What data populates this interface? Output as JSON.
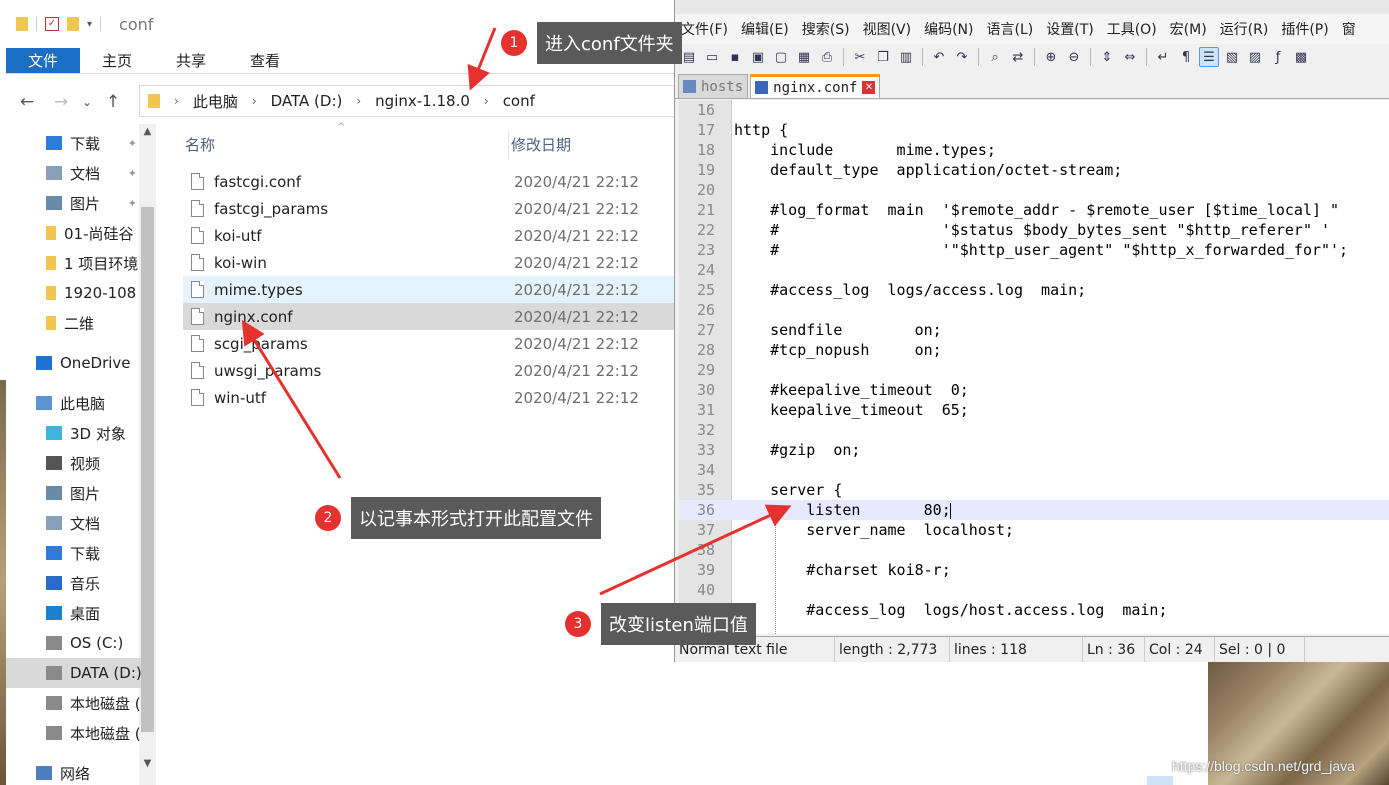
{
  "explorer": {
    "title": "conf",
    "ribbon_tabs": [
      "文件",
      "主页",
      "共享",
      "查看"
    ],
    "breadcrumbs": [
      "此电脑",
      "DATA (D:)",
      "nginx-1.18.0",
      "conf"
    ],
    "nav_items": [
      {
        "label": "下载",
        "icon": "download-arrow-icon",
        "pinned": true
      },
      {
        "label": "文档",
        "icon": "document-icon",
        "pinned": true
      },
      {
        "label": "图片",
        "icon": "picture-icon",
        "pinned": true
      },
      {
        "label": "01-尚硅谷",
        "icon": "folder-icon"
      },
      {
        "label": "1 项目环境",
        "icon": "folder-icon"
      },
      {
        "label": "1920-108",
        "icon": "folder-icon"
      },
      {
        "label": "二维",
        "icon": "folder-icon"
      },
      {
        "label": "OneDrive",
        "icon": "cloud-icon"
      },
      {
        "label": "此电脑",
        "icon": "computer-icon"
      },
      {
        "label": "3D 对象",
        "icon": "cube-icon"
      },
      {
        "label": "视频",
        "icon": "video-icon"
      },
      {
        "label": "图片",
        "icon": "picture-icon"
      },
      {
        "label": "文档",
        "icon": "document-icon"
      },
      {
        "label": "下载",
        "icon": "download-arrow-icon"
      },
      {
        "label": "音乐",
        "icon": "music-icon"
      },
      {
        "label": "桌面",
        "icon": "desktop-icon"
      },
      {
        "label": "OS (C:)",
        "icon": "drive-icon"
      },
      {
        "label": "DATA (D:)",
        "icon": "drive-icon",
        "selected": true
      },
      {
        "label": "本地磁盘 (",
        "icon": "drive-icon"
      },
      {
        "label": "本地磁盘 (",
        "icon": "drive-icon"
      },
      {
        "label": "网络",
        "icon": "network-icon"
      }
    ],
    "columns": {
      "name": "名称",
      "date": "修改日期"
    },
    "files": [
      {
        "name": "fastcgi.conf",
        "date": "2020/4/21 22:12"
      },
      {
        "name": "fastcgi_params",
        "date": "2020/4/21 22:12"
      },
      {
        "name": "koi-utf",
        "date": "2020/4/21 22:12"
      },
      {
        "name": "koi-win",
        "date": "2020/4/21 22:12"
      },
      {
        "name": "mime.types",
        "date": "2020/4/21 22:12",
        "state": "hover"
      },
      {
        "name": "nginx.conf",
        "date": "2020/4/21 22:12",
        "state": "selected"
      },
      {
        "name": "scgi_params",
        "date": "2020/4/21 22:12"
      },
      {
        "name": "uwsgi_params",
        "date": "2020/4/21 22:12"
      },
      {
        "name": "win-utf",
        "date": "2020/4/21 22:12"
      }
    ]
  },
  "notepad": {
    "menu": [
      "文件(F)",
      "编辑(E)",
      "搜索(S)",
      "视图(V)",
      "编码(N)",
      "语言(L)",
      "设置(T)",
      "工具(O)",
      "宏(M)",
      "运行(R)",
      "插件(P)",
      "窗"
    ],
    "tabs": [
      {
        "label": "hosts",
        "active": false
      },
      {
        "label": "nginx.conf",
        "active": true
      }
    ],
    "lines": [
      {
        "n": "16",
        "text": ""
      },
      {
        "n": "17",
        "text": "http {"
      },
      {
        "n": "18",
        "text": "    include       mime.types;"
      },
      {
        "n": "19",
        "text": "    default_type  application/octet-stream;"
      },
      {
        "n": "20",
        "text": ""
      },
      {
        "n": "21",
        "text": "    #log_format  main  '$remote_addr - $remote_user [$time_local] \""
      },
      {
        "n": "22",
        "text": "    #                  '$status $body_bytes_sent \"$http_referer\" '"
      },
      {
        "n": "23",
        "text": "    #                  '\"$http_user_agent\" \"$http_x_forwarded_for\"';"
      },
      {
        "n": "24",
        "text": ""
      },
      {
        "n": "25",
        "text": "    #access_log  logs/access.log  main;"
      },
      {
        "n": "26",
        "text": ""
      },
      {
        "n": "27",
        "text": "    sendfile        on;"
      },
      {
        "n": "28",
        "text": "    #tcp_nopush     on;"
      },
      {
        "n": "29",
        "text": ""
      },
      {
        "n": "30",
        "text": "    #keepalive_timeout  0;"
      },
      {
        "n": "31",
        "text": "    keepalive_timeout  65;"
      },
      {
        "n": "32",
        "text": ""
      },
      {
        "n": "33",
        "text": "    #gzip  on;"
      },
      {
        "n": "34",
        "text": ""
      },
      {
        "n": "35",
        "text": "    server {"
      },
      {
        "n": "36",
        "text": "        listen       80;",
        "current": true
      },
      {
        "n": "37",
        "text": "        server_name  localhost;"
      },
      {
        "n": "38",
        "text": ""
      },
      {
        "n": "39",
        "text": "        #charset koi8-r;"
      },
      {
        "n": "40",
        "text": ""
      },
      {
        "n": "41",
        "text": "        #access_log  logs/host.access.log  main;"
      }
    ],
    "status": {
      "type": "Normal text file",
      "length": "length : 2,773",
      "lines": "lines : 118",
      "ln": "Ln : 36",
      "col": "Col : 24",
      "sel": "Sel : 0 | 0"
    }
  },
  "callouts": [
    {
      "num": "1",
      "text": "进入conf文件夹"
    },
    {
      "num": "2",
      "text": "以记事本形式打开此配置文件"
    },
    {
      "num": "3",
      "text": "改变listen端口值"
    }
  ],
  "watermark": "https://blog.csdn.net/grd_java",
  "colors": {
    "accent": "#1a6fc4",
    "annotation": "#e6322f",
    "callout_bg": "#5a5a5a"
  }
}
